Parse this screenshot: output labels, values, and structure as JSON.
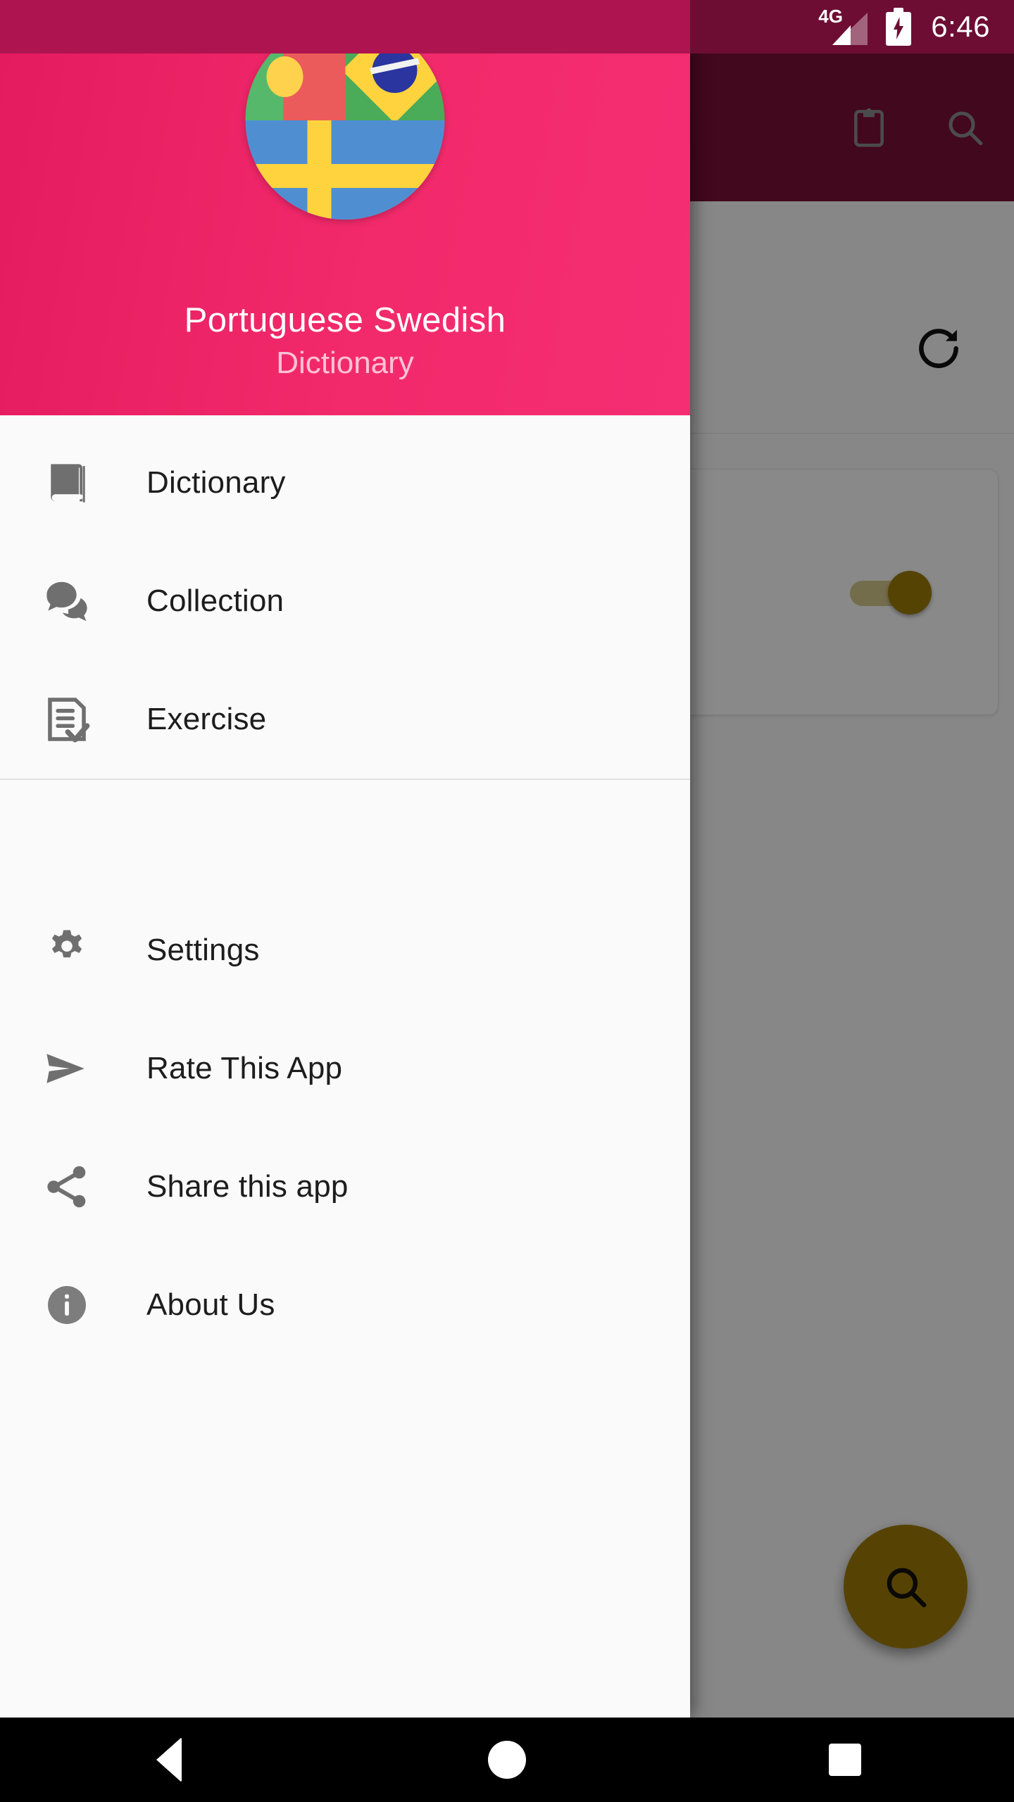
{
  "status_bar": {
    "network_label": "4G",
    "time": "6:46",
    "signal_icon": "signal-bars-icon",
    "battery_icon": "battery-charging-icon"
  },
  "app_bar": {
    "actions": [
      {
        "icon": "clipboard-icon",
        "name": "clipboard-button"
      },
      {
        "icon": "search-icon",
        "name": "search-button"
      }
    ]
  },
  "background_content": {
    "refresh_icon": "refresh-icon",
    "toggle": {
      "state": "on",
      "name": "setting-toggle"
    },
    "fab": {
      "icon": "search-icon",
      "name": "search-fab"
    }
  },
  "drawer": {
    "header": {
      "avatar_icon": "flag-composite-icon",
      "title": "Portuguese Swedish",
      "subtitle": "Dictionary",
      "background_color": "#f22a6c",
      "title_color": "#ffffff",
      "subtitle_color": "#ffc2d6"
    },
    "primary_items": [
      {
        "label": "Dictionary",
        "icon": "book-icon"
      },
      {
        "label": "Collection",
        "icon": "chat-bubbles-icon"
      },
      {
        "label": "Exercise",
        "icon": "checklist-icon"
      }
    ],
    "secondary_items": [
      {
        "label": "Settings",
        "icon": "gear-icon"
      },
      {
        "label": "Rate This App",
        "icon": "send-icon"
      },
      {
        "label": "Share this app",
        "icon": "share-icon"
      },
      {
        "label": "About Us",
        "icon": "info-icon"
      }
    ]
  },
  "navigation_bar": {
    "buttons": [
      {
        "name": "back-button",
        "icon": "triangle-back-icon"
      },
      {
        "name": "home-button",
        "icon": "circle-home-icon"
      },
      {
        "name": "recents-button",
        "icon": "square-recents-icon"
      }
    ]
  },
  "colors": {
    "accent_pink": "#f22a6c",
    "app_bar_maroon": "#7a0f39",
    "status_bar_maroon": "#6d0d33",
    "fab_gold": "#a07c06",
    "drawer_bg": "#fafafa"
  }
}
